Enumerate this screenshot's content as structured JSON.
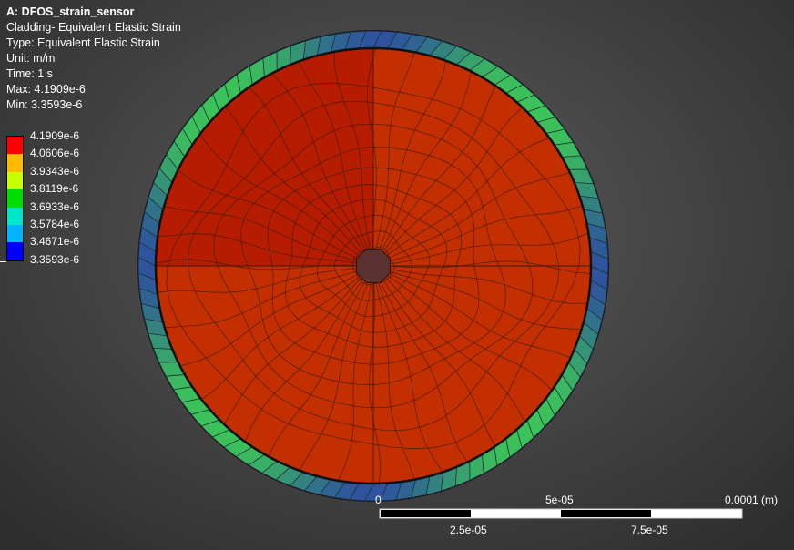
{
  "info": {
    "title": "A: DFOS_strain_sensor",
    "object": "Cladding- Equivalent Elastic Strain",
    "type": "Type: Equivalent Elastic Strain",
    "unit": "Unit: m/m",
    "time": "Time: 1 s",
    "max": "Max: 4.1909e-6",
    "min": "Min: 3.3593e-6"
  },
  "legend": {
    "labels": [
      "4.1909e-6",
      "4.0606e-6",
      "3.9343e-6",
      "3.8119e-6",
      "3.6933e-6",
      "3.5784e-6",
      "3.4671e-6",
      "3.3593e-6"
    ],
    "colors": [
      "#ff0000",
      "#ffbb00",
      "#c8ff00",
      "#00dd00",
      "#00e6c8",
      "#00b4ff",
      "#0000ff"
    ]
  },
  "scale": {
    "top_labels": [
      "0",
      "5e-05",
      "0.0001 (m)"
    ],
    "bottom_labels": [
      "2.5e-05",
      "7.5e-05"
    ]
  },
  "colors": {
    "core_red": "#c42f02",
    "core_upper_left": "#b51c00",
    "core_center": "#5a3030",
    "cladding_green": "#3cc25a",
    "cladding_blue": "#2a40a8",
    "mesh_line": "#3a1a08"
  }
}
